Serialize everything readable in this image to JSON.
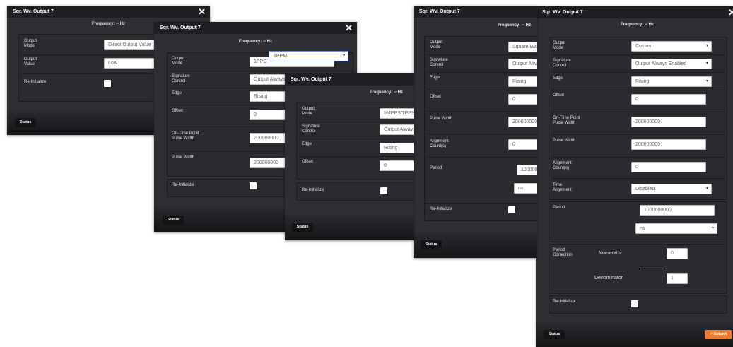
{
  "dialog_title": "Sqr. Wv. Output 7",
  "close_glyph": "✕",
  "frequency_label": "Frequency: -- Hz",
  "status_label": "Status",
  "submit_label": "✓ Submit",
  "labels": {
    "output_mode": "Output Mode",
    "output_value": "Output Value",
    "re_initialize": "Re-Initialize",
    "signature_control": "Signature Control",
    "edge": "Edge",
    "offset": "Offset",
    "on_time": "On-Time Point Pulse Width",
    "pulse_width": "Pulse Width",
    "alignment_count": "Alignment Count(s)",
    "period": "Period",
    "time_alignment": "Time Alignment",
    "period_correction": "Period Correction",
    "numerator": "Numerator",
    "denominator": "Denominator"
  },
  "panel1": {
    "output_mode": "Direct Output Value",
    "output_value": "Low"
  },
  "panel2": {
    "output_mode": "1PPS",
    "dropdown_open": "1PPM",
    "signature_control": "Output Always Enabled",
    "edge": "Rising",
    "offset": "0",
    "on_time": "200000000",
    "pulse_width": "200000000"
  },
  "panel3": {
    "output_mode": "5MPPS/1PPS",
    "signature_control": "Output Always Enabled",
    "edge": "Rising",
    "offset": "0"
  },
  "panel4": {
    "output_mode": "Square Wave",
    "signature_control": "Output Always Enabled",
    "edge": "Rising",
    "offset": "0",
    "pulse_width": "200000000",
    "alignment_count": "0",
    "period": "1000000000",
    "period_unit": "ns"
  },
  "panel5": {
    "output_mode": "Custom",
    "signature_control": "Output Always Enabled",
    "edge": "Rising",
    "offset": "0",
    "on_time": "200000000",
    "pulse_width": "200000000",
    "alignment_count": "0",
    "time_alignment": "Disabled",
    "period": "1000000000",
    "period_unit": "ns",
    "numerator": "0",
    "denominator": "1"
  },
  "colors": {
    "panel": "#2f2e33",
    "titlebar": "#1f1e22",
    "submit": "#f07a2a"
  }
}
